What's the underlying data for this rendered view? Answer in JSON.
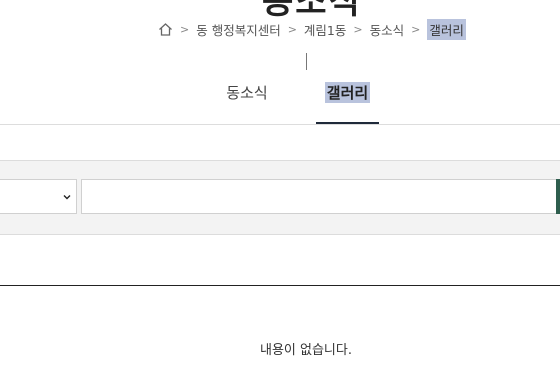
{
  "page_title_fragment": "동소식",
  "breadcrumb": {
    "home_icon": "home-icon",
    "items": [
      "동 행정복지센터",
      "계림1동",
      "동소식"
    ],
    "current": "갤러리",
    "separator": ">"
  },
  "tabs": [
    {
      "label": "동소식",
      "active": false
    },
    {
      "label": "갤러리",
      "active": true
    }
  ],
  "search": {
    "select_value": "",
    "input_value": "",
    "input_placeholder": ""
  },
  "list": {
    "empty_message": "내용이 없습니다."
  },
  "colors": {
    "highlight": "#b9c3dd",
    "active_tab_underline": "#1f2a3a",
    "accent": "#2e5e4e"
  }
}
